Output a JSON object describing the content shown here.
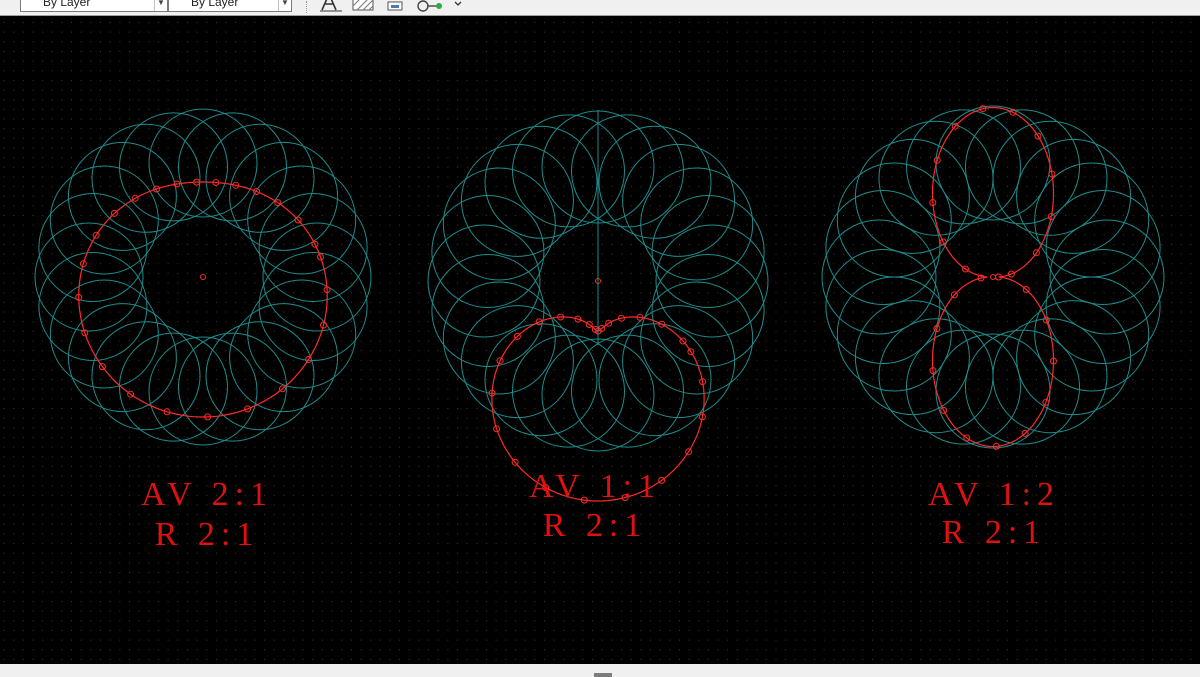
{
  "toolbar": {
    "linetype_value": "By Layer",
    "lineweight_value": "By Layer",
    "icons": [
      "text-style-icon",
      "hatch-icon",
      "table-icon",
      "layer-tool-icon"
    ]
  },
  "colors": {
    "background": "#000000",
    "grid": "#3a3a3a",
    "circles": "#1f8c8c",
    "curve": "#ff2a2a",
    "label": "#e01010"
  },
  "figures": [
    {
      "name": "av-2-1",
      "line1": "AV 2:1",
      "line2": "R 2:1"
    },
    {
      "name": "av-1-1",
      "line1": "AV 1:1",
      "line2": "R 2:1"
    },
    {
      "name": "av-1-2",
      "line1": "AV 1:2",
      "line2": "R 2:1"
    }
  ]
}
